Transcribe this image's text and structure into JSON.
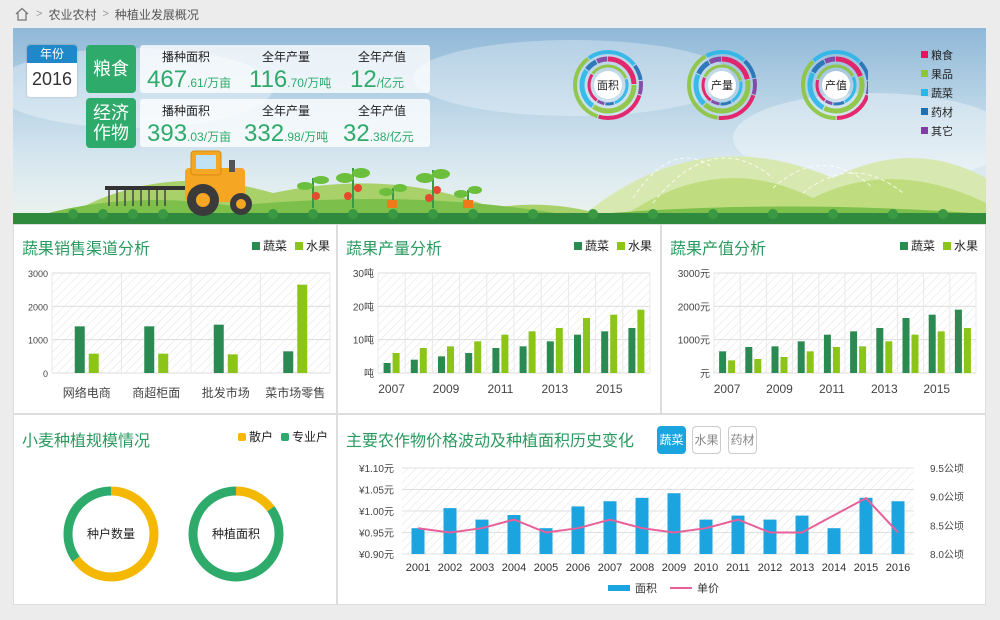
{
  "breadcrumb": [
    "农业农村",
    "种植业发展概况"
  ],
  "banner": {
    "year_label": "年份",
    "year_value": "2016",
    "groups": [
      {
        "name": "粮食",
        "stats": [
          {
            "title": "播种面积",
            "int": "467",
            "dec": ".61",
            "unit": "/万亩"
          },
          {
            "title": "全年产量",
            "int": "116",
            "dec": ".70",
            "unit": "/万吨"
          },
          {
            "title": "全年产值",
            "int": "12",
            "dec": "",
            "unit": "/亿元"
          }
        ]
      },
      {
        "name": "经济作物",
        "stats": [
          {
            "title": "播种面积",
            "int": "393",
            "dec": ".03",
            "unit": "/万亩"
          },
          {
            "title": "全年产量",
            "int": "332",
            "dec": ".98",
            "unit": "/万吨"
          },
          {
            "title": "全年产值",
            "int": "32",
            "dec": ".38",
            "unit": "/亿元"
          }
        ]
      }
    ],
    "rings": [
      "面积",
      "产量",
      "产值"
    ],
    "legend": [
      {
        "name": "粮食",
        "color": "#e6145f"
      },
      {
        "name": "果品",
        "color": "#8cc43c"
      },
      {
        "name": "蔬菜",
        "color": "#29b6e8"
      },
      {
        "name": "药材",
        "color": "#1f6fb5"
      },
      {
        "name": "其它",
        "color": "#7e3fa0"
      }
    ]
  },
  "colors": {
    "veg": "#2a8a52",
    "fruit": "#8cc418",
    "bar": "#1aa5e0",
    "line": "#e8609a",
    "retail": "#f5b800",
    "pro": "#2eaa6a"
  },
  "panel_sales": {
    "title": "蔬果销售渠道分析",
    "legend": [
      "蔬菜",
      "水果"
    ]
  },
  "panel_output": {
    "title": "蔬果产量分析",
    "legend": [
      "蔬菜",
      "水果"
    ]
  },
  "panel_value": {
    "title": "蔬果产值分析",
    "legend": [
      "蔬菜",
      "水果"
    ]
  },
  "panel_wheat": {
    "title": "小麦种植规模情况",
    "legend": [
      "散户",
      "专业户"
    ],
    "donuts": [
      "种户数量",
      "种植面积"
    ]
  },
  "panel_price": {
    "title": "主要农作物价格波动及种植面积历史变化",
    "tabs": [
      "蔬菜",
      "水果",
      "药材"
    ],
    "legend": [
      "面积",
      "单价"
    ]
  },
  "chart_data": [
    {
      "type": "bar",
      "title": "蔬果销售渠道分析",
      "categories": [
        "网络电商",
        "商超柜面",
        "批发市场",
        "菜市场零售"
      ],
      "series": [
        {
          "name": "蔬菜",
          "values": [
            1400,
            1400,
            1450,
            650
          ]
        },
        {
          "name": "水果",
          "values": [
            580,
            580,
            560,
            2650
          ]
        }
      ],
      "yticks": [
        "0",
        "1000",
        "2000",
        "3000"
      ],
      "ylim": [
        0,
        3000
      ]
    },
    {
      "type": "bar",
      "title": "蔬果产量分析",
      "categories": [
        "2007",
        "2008",
        "2009",
        "2010",
        "2011",
        "2012",
        "2013",
        "2014",
        "2015",
        "2016"
      ],
      "series": [
        {
          "name": "蔬菜",
          "values": [
            3,
            4,
            5,
            6,
            7.5,
            8,
            9.5,
            11.5,
            12.5,
            13.5
          ]
        },
        {
          "name": "水果",
          "values": [
            6,
            7.5,
            8,
            9.5,
            11.5,
            12.5,
            13.5,
            16.5,
            17.5,
            19
          ]
        }
      ],
      "xticks": [
        "2007",
        "2009",
        "2011",
        "2013",
        "2015"
      ],
      "yticks": [
        "吨",
        "10吨",
        "20吨",
        "30吨"
      ],
      "ylim": [
        0,
        30
      ]
    },
    {
      "type": "bar",
      "title": "蔬果产值分析",
      "categories": [
        "2007",
        "2008",
        "2009",
        "2010",
        "2011",
        "2012",
        "2013",
        "2014",
        "2015",
        "2016"
      ],
      "series": [
        {
          "name": "蔬菜",
          "values": [
            650,
            780,
            800,
            950,
            1150,
            1250,
            1350,
            1650,
            1750,
            1900
          ]
        },
        {
          "name": "水果",
          "values": [
            380,
            420,
            480,
            650,
            780,
            800,
            950,
            1150,
            1250,
            1350
          ]
        }
      ],
      "xticks": [
        "2007",
        "2009",
        "2011",
        "2013",
        "2015"
      ],
      "yticks": [
        "元",
        "1000元",
        "2000元",
        "3000元"
      ],
      "ylim": [
        0,
        3000
      ]
    },
    {
      "type": "pie",
      "title": "小麦种植规模情况",
      "charts": [
        {
          "label": "种户数量",
          "slices": [
            {
              "name": "散户",
              "value": 65
            },
            {
              "name": "专业户",
              "value": 35
            }
          ]
        },
        {
          "label": "种植面积",
          "slices": [
            {
              "name": "散户",
              "value": 15
            },
            {
              "name": "专业户",
              "value": 85
            }
          ]
        }
      ]
    },
    {
      "type": "bar",
      "title": "主要农作物价格波动及种植面积历史变化",
      "x": [
        "2001",
        "2002",
        "2003",
        "2004",
        "2005",
        "2006",
        "2007",
        "2008",
        "2009",
        "2010",
        "2011",
        "2012",
        "2013",
        "2014",
        "2015",
        "2016"
      ],
      "series": [
        {
          "name": "面积",
          "axis": "right",
          "values": [
            8.45,
            8.8,
            8.6,
            8.68,
            8.45,
            8.83,
            8.92,
            8.98,
            9.06,
            8.6,
            8.67,
            8.6,
            8.67,
            8.45,
            8.98,
            8.92
          ]
        },
        {
          "name": "单价",
          "axis": "left",
          "values": [
            0.96,
            0.95,
            0.96,
            0.98,
            0.95,
            0.96,
            0.98,
            0.96,
            0.95,
            0.96,
            0.98,
            0.95,
            0.95,
            0.99,
            1.03,
            0.95
          ]
        }
      ],
      "left_ticks": [
        "¥0.90元",
        "¥0.95元",
        "¥1.00元",
        "¥1.05元",
        "¥1.10元"
      ],
      "left_lim": [
        0.9,
        1.1
      ],
      "right_ticks": [
        "8.0公顷",
        "8.5公顷",
        "9.0公顷",
        "9.5公顷"
      ],
      "right_lim": [
        8.0,
        9.5
      ]
    }
  ]
}
